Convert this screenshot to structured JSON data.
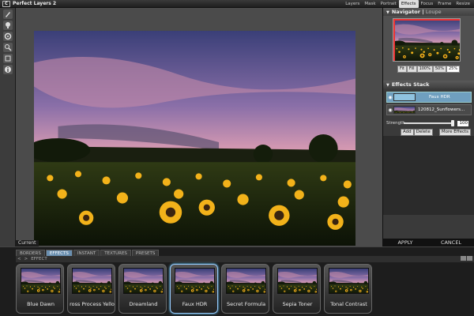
{
  "app": {
    "logo": "C",
    "title": "Perfect Layers 2"
  },
  "modules": [
    "Layers",
    "Mask",
    "Portrait",
    "Effects",
    "Focus",
    "Frame",
    "Resize"
  ],
  "active_module": "Effects",
  "tools": [
    "brush-icon",
    "lightbulb-icon",
    "gear-icon",
    "magnify-icon",
    "settings-icon",
    "info-icon"
  ],
  "canvas": {
    "current_label": "Current"
  },
  "navigator": {
    "title": "Navigator",
    "loupe": "Loupe",
    "zoom": [
      "Fit",
      "Fill",
      "100%",
      "50%",
      "25%"
    ],
    "active_zoom": "25%"
  },
  "effects_stack": {
    "title": "Effects Stack",
    "layers": [
      {
        "name": "Faux HDR",
        "selected": true
      },
      {
        "name": "120812_Sunflowers...",
        "selected": false
      }
    ],
    "strength_label": "Strength",
    "strength_value": "100",
    "strength_fraction": 1.0,
    "add": "Add",
    "delete": "Delete",
    "more": "More Effects"
  },
  "actions": {
    "apply": "APPLY",
    "cancel": "CANCEL"
  },
  "browser": {
    "tabs": [
      "BORDERS",
      "EFFECTS",
      "INSTANT",
      "TEXTURES",
      "PRESETS"
    ],
    "active_tab": "EFFECTS",
    "path": [
      "<",
      ">",
      "EFFECT"
    ],
    "presets": [
      {
        "name": "Blue Dawn",
        "selected": false
      },
      {
        "name": "ross Process Yello",
        "selected": false
      },
      {
        "name": "Dreamland",
        "selected": false
      },
      {
        "name": "Faux HDR",
        "selected": true
      },
      {
        "name": "Secret Formula",
        "selected": false
      },
      {
        "name": "Sepia Toner",
        "selected": false
      },
      {
        "name": "Tonal Contrast",
        "selected": false
      }
    ]
  },
  "colors": {
    "selection": "#6f9fbf",
    "accent": "#9ccfff"
  }
}
